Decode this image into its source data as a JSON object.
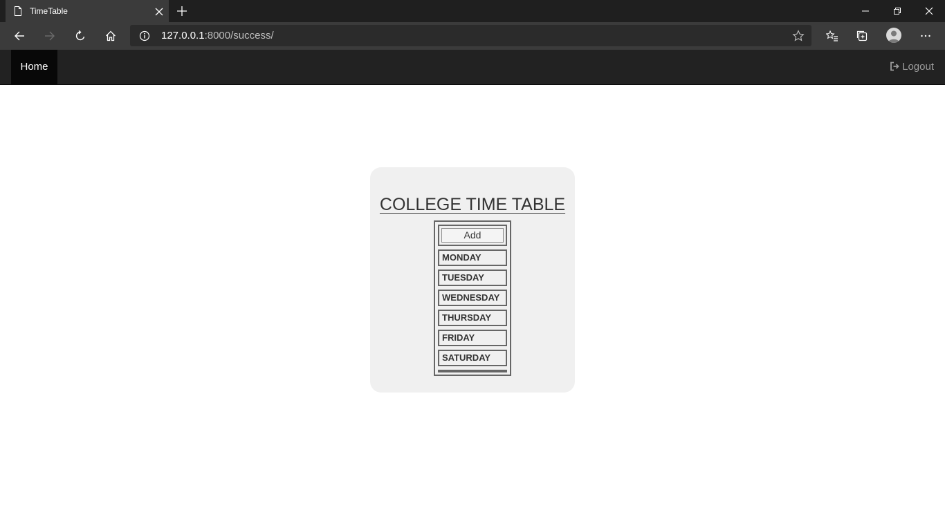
{
  "browser": {
    "tab_title": "TimeTable",
    "url_host": "127.0.0.1",
    "url_rest": ":8000/success/"
  },
  "navbar": {
    "home_label": "Home",
    "logout_label": "Logout"
  },
  "card": {
    "title": "COLLEGE TIME TABLE",
    "add_label": "Add",
    "days": [
      "MONDAY",
      "TUESDAY",
      "WEDNESDAY",
      "THURSDAY",
      "FRIDAY",
      "SATURDAY"
    ]
  },
  "colors": {
    "tabstrip": "#1f1f1f",
    "toolbar": "#3b3b3b",
    "navbar": "#222222",
    "card_bg": "#f0f0f0"
  },
  "icons": {
    "tab": "page-icon",
    "close": "close-icon",
    "new_tab": "plus-icon",
    "back": "back-arrow-icon",
    "forward": "forward-arrow-icon",
    "refresh": "refresh-icon",
    "home": "home-icon",
    "info": "info-icon",
    "favorite": "star-icon",
    "favorites": "favorites-icon",
    "collections": "collections-icon",
    "profile": "avatar",
    "menu": "more-icon",
    "logout": "logout-icon"
  }
}
